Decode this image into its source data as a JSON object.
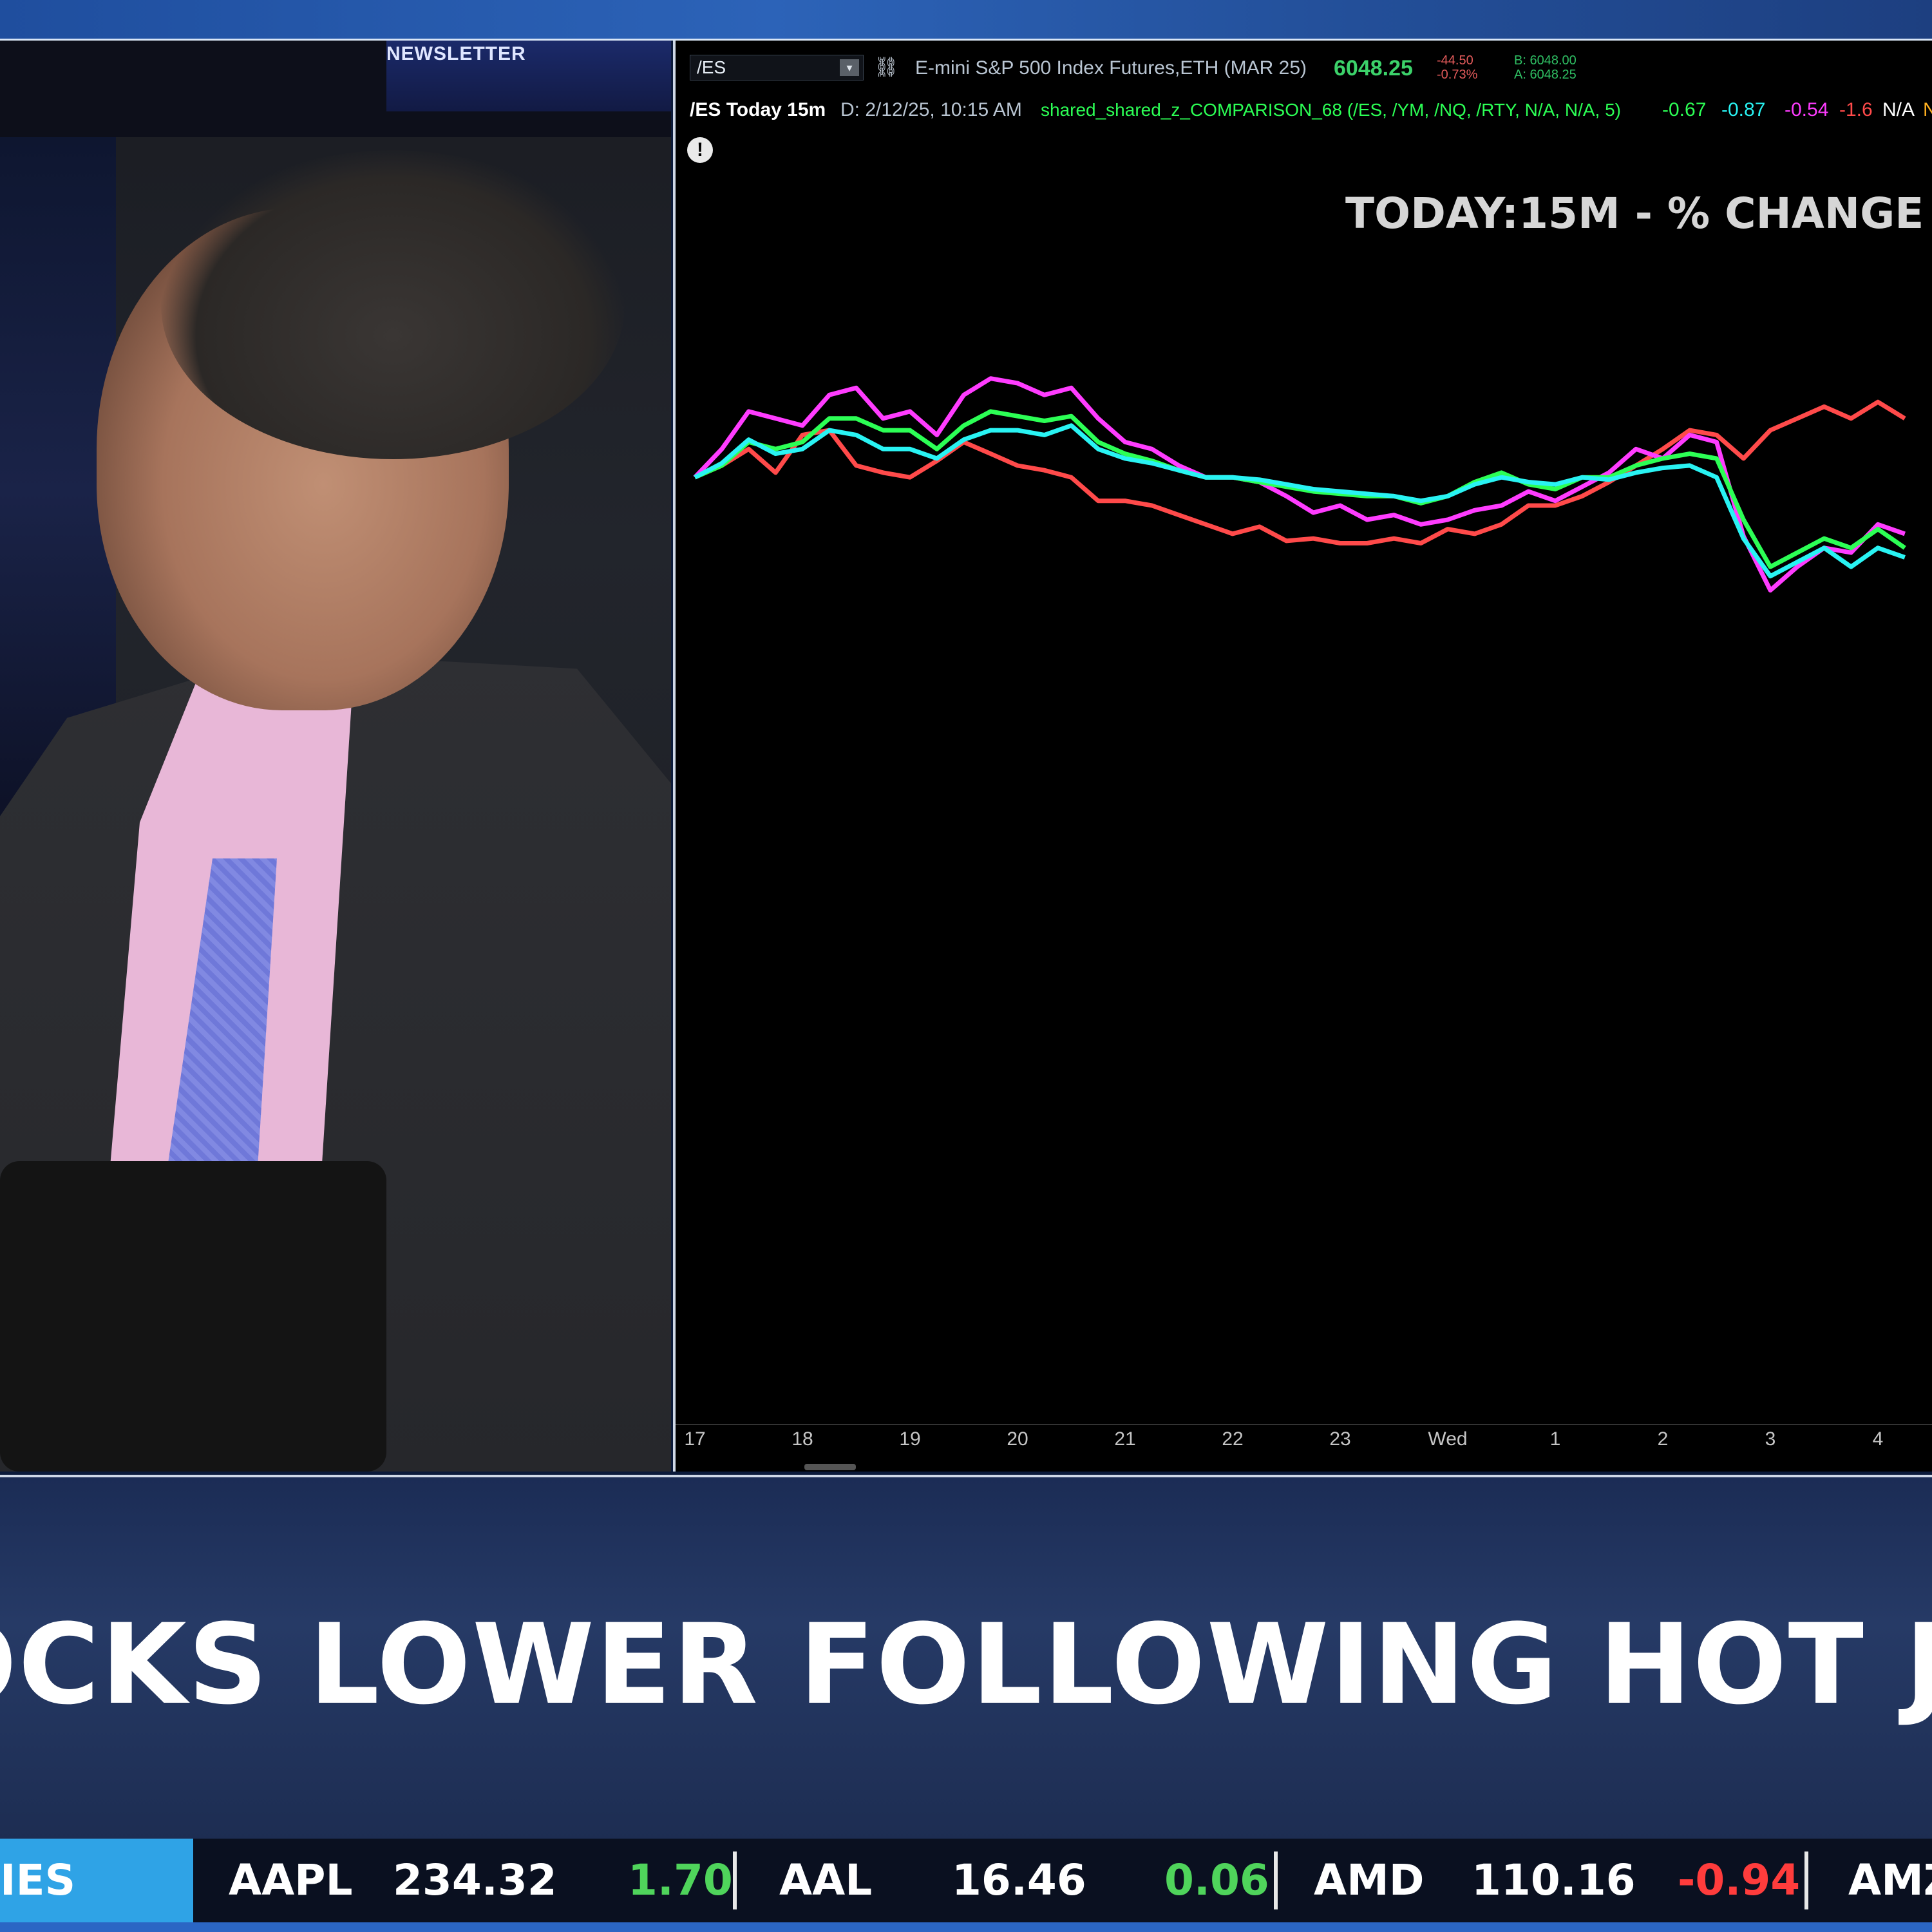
{
  "colors": {
    "es": "#ff4a4a",
    "ym": "#2cff55",
    "nq": "#29f3f3",
    "rty": "#ff3cff",
    "price_up": "#3cd26a",
    "change_down": "#e25a5a",
    "ticker_label_bg": "#2fa3e6"
  },
  "studio": {
    "sign": "NEWSLETTER"
  },
  "chart_window": {
    "symbol": "/ES",
    "dropdown_icon": "chevron-down-icon",
    "description": "E-mini S&P 500 Index Futures,ETH (MAR 25)",
    "last_price": "6048.25",
    "net_change": "-44.50",
    "pct_change": "-0.73%",
    "bid": "B: 6048.00",
    "ask": "A: 6048.25",
    "title_bar": {
      "label": "/ES Today 15m",
      "datetime": "D: 2/12/25, 10:15 AM",
      "study": "shared_shared_z_COMPARISON_68 (/ES, /YM, /NQ, /RTY, N/A, N/A, 5)",
      "v1": "-0.67",
      "v2": "-0.87",
      "v3": "-0.54",
      "v4": "-1.6",
      "v5": "N/A",
      "v6": "N"
    },
    "study_icon": "!"
  },
  "chart_data": {
    "type": "line",
    "title": "TODAY:15M - % CHANGE",
    "x_ticks": [
      "17",
      "18",
      "19",
      "20",
      "21",
      "22",
      "23",
      "Wed",
      "1",
      "2",
      "3",
      "4"
    ],
    "ylim": [
      -4.0,
      1.5
    ],
    "series": [
      {
        "color": "#ff4a4a",
        "values": [
          0.0,
          0.05,
          0.12,
          0.02,
          0.18,
          0.2,
          0.05,
          0.02,
          0.0,
          0.07,
          0.15,
          0.1,
          0.05,
          0.03,
          0.0,
          -0.1,
          -0.1,
          -0.12,
          -0.16,
          -0.2,
          -0.24,
          -0.21,
          -0.27,
          -0.26,
          -0.28,
          -0.28,
          -0.26,
          -0.28,
          -0.22,
          -0.24,
          -0.2,
          -0.12,
          -0.12,
          -0.08,
          -0.02,
          0.05,
          0.12,
          0.2,
          0.18,
          0.08,
          0.2,
          0.25,
          0.3,
          0.25,
          0.32,
          0.25
        ]
      },
      {
        "color": "#ff3cff",
        "values": [
          0.0,
          0.12,
          0.28,
          0.25,
          0.22,
          0.35,
          0.38,
          0.25,
          0.28,
          0.18,
          0.35,
          0.42,
          0.4,
          0.35,
          0.38,
          0.25,
          0.15,
          0.12,
          0.05,
          0.0,
          0.0,
          -0.02,
          -0.08,
          -0.15,
          -0.12,
          -0.18,
          -0.16,
          -0.2,
          -0.18,
          -0.14,
          -0.12,
          -0.06,
          -0.1,
          -0.04,
          0.02,
          0.12,
          0.08,
          0.18,
          0.15,
          -0.25,
          -0.48,
          -0.38,
          -0.3,
          -0.32,
          -0.2,
          -0.24
        ]
      },
      {
        "color": "#2cff55",
        "values": [
          0.0,
          0.05,
          0.15,
          0.12,
          0.15,
          0.25,
          0.25,
          0.2,
          0.2,
          0.12,
          0.22,
          0.28,
          0.26,
          0.24,
          0.26,
          0.15,
          0.1,
          0.07,
          0.03,
          0.0,
          0.0,
          -0.02,
          -0.04,
          -0.06,
          -0.07,
          -0.08,
          -0.08,
          -0.11,
          -0.08,
          -0.02,
          0.02,
          -0.03,
          -0.05,
          0.0,
          0.0,
          0.05,
          0.08,
          0.1,
          0.08,
          -0.18,
          -0.38,
          -0.32,
          -0.26,
          -0.3,
          -0.22,
          -0.3
        ]
      },
      {
        "color": "#29f3f3",
        "values": [
          0.0,
          0.06,
          0.16,
          0.1,
          0.12,
          0.2,
          0.18,
          0.12,
          0.12,
          0.08,
          0.16,
          0.2,
          0.2,
          0.18,
          0.22,
          0.12,
          0.08,
          0.06,
          0.03,
          0.0,
          0.0,
          -0.01,
          -0.03,
          -0.05,
          -0.06,
          -0.07,
          -0.08,
          -0.1,
          -0.08,
          -0.03,
          0.0,
          -0.02,
          -0.03,
          0.0,
          -0.01,
          0.02,
          0.04,
          0.05,
          0.0,
          -0.26,
          -0.42,
          -0.36,
          -0.3,
          -0.38,
          -0.3,
          -0.34
        ]
      }
    ]
  },
  "headline": "OCKS LOWER FOLLOWING HOT JANUARY C",
  "ticker": {
    "label": "IES",
    "items": [
      {
        "symbol": "AAPL",
        "price": "234.32",
        "change": "1.70"
      },
      {
        "symbol": "AAL",
        "price": "16.46",
        "change": "0.06"
      },
      {
        "symbol": "AMD",
        "price": "110.16",
        "change": "-0.94"
      },
      {
        "symbol": "AMZ",
        "price": "",
        "change": ""
      }
    ]
  }
}
